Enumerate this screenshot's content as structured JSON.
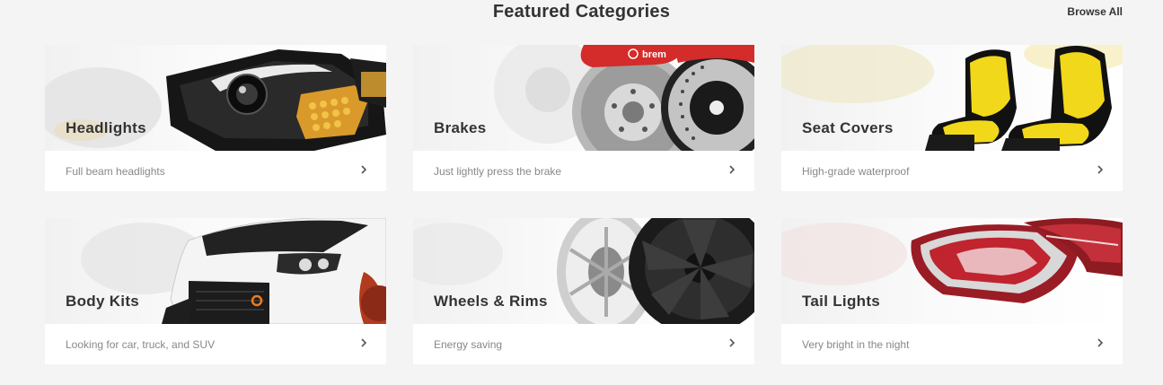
{
  "header": {
    "title": "Featured Categories",
    "browse_all": "Browse All"
  },
  "categories": [
    {
      "title": "Headlights",
      "description": "Full beam headlights",
      "image_icon": "headlight-image"
    },
    {
      "title": "Brakes",
      "description": "Just lightly press the brake",
      "image_icon": "brake-disc-image",
      "brand_text": "brem"
    },
    {
      "title": "Seat Covers",
      "description": "High-grade waterproof",
      "image_icon": "racing-seat-image"
    },
    {
      "title": "Body Kits",
      "description": "Looking for car, truck, and SUV",
      "image_icon": "car-front-image"
    },
    {
      "title": "Wheels & Rims",
      "description": "Energy saving",
      "image_icon": "wheel-rim-image"
    },
    {
      "title": "Tail Lights",
      "description": "Very bright in the night",
      "image_icon": "tail-light-image"
    }
  ],
  "colors": {
    "background": "#f4f4f4",
    "card": "#ffffff",
    "title": "#333333",
    "description": "#888888",
    "brake_caliper": "#d42b2b",
    "seat_yellow": "#f2d81a",
    "tail_red": "#c0242e"
  }
}
